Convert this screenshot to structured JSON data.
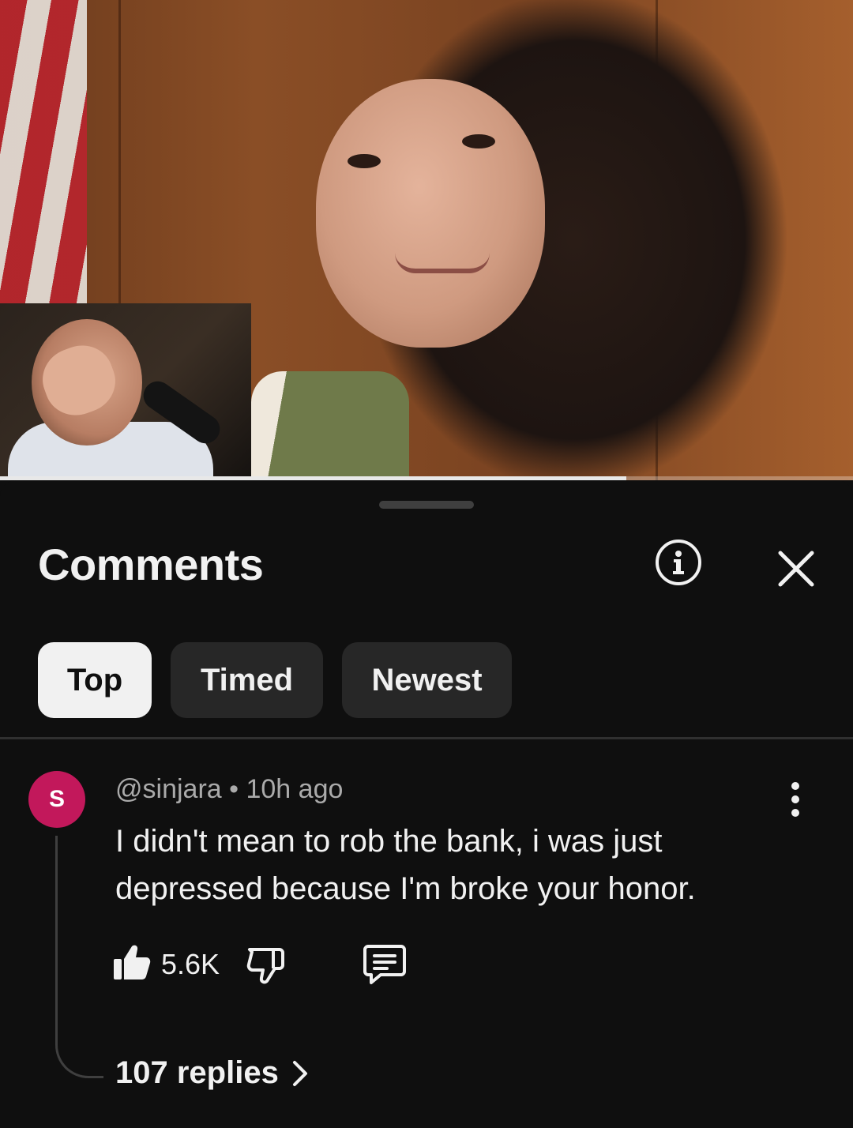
{
  "video": {
    "progress_fraction": 0.734,
    "thumbnail": "courtroom-woman-with-facecam",
    "colors": {
      "progress_fill": "#e8e8e8",
      "progress_track": "#5a5a5a"
    }
  },
  "comments_panel": {
    "title": "Comments",
    "info_icon": "info-icon",
    "close_icon": "close-icon",
    "sort_chips": [
      {
        "label": "Top",
        "active": true
      },
      {
        "label": "Timed",
        "active": false
      },
      {
        "label": "Newest",
        "active": false
      }
    ]
  },
  "comment": {
    "avatar_letter": "S",
    "avatar_color": "#c2185b",
    "author": "@sinjara",
    "separator": "•",
    "time": "10h ago",
    "text": "I didn't mean to rob the bank, i was just depressed because I'm broke your honor.",
    "like_count": "5.6K",
    "icons": [
      "thumbs-up-icon",
      "thumbs-down-icon",
      "reply-icon",
      "more-vertical-icon"
    ],
    "replies_label": "107 replies"
  }
}
